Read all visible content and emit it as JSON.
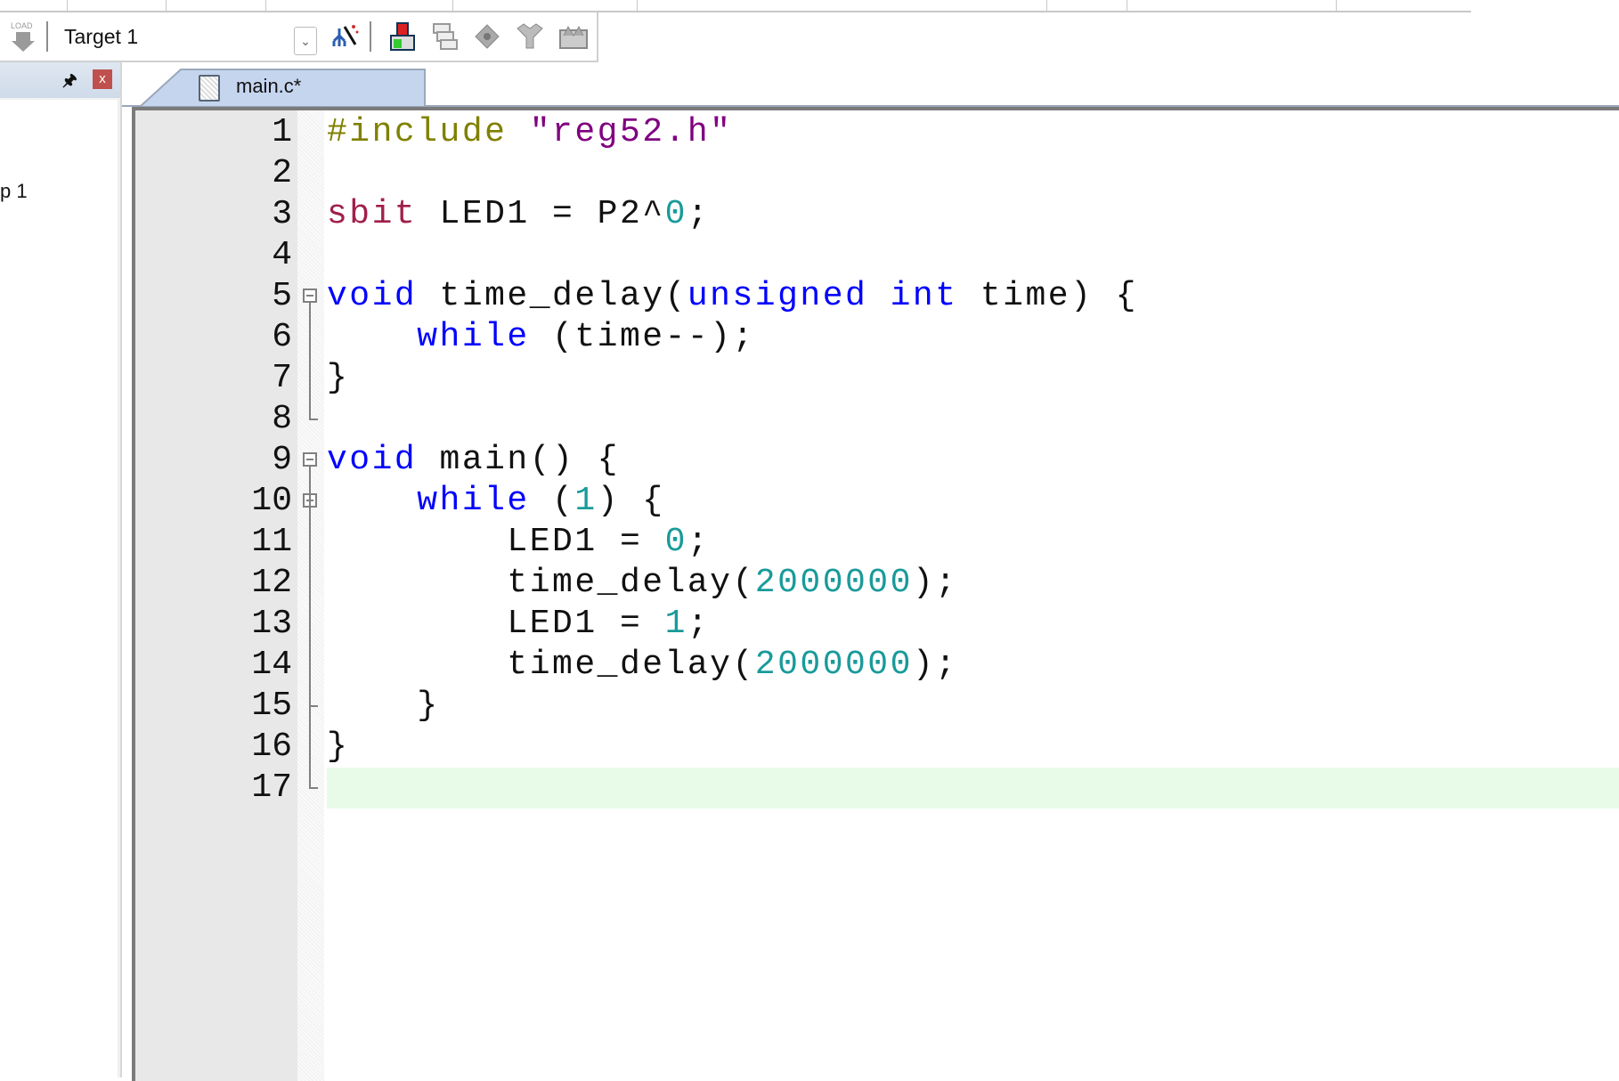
{
  "toolbar": {
    "load_icon_text": "LOAD",
    "target_select": "Target 1",
    "icons": [
      "load-icon",
      "magic-wand-icon",
      "manage-components-icon",
      "batch-build-icon",
      "options-icon",
      "filter-icon",
      "packs-icon"
    ]
  },
  "project_panel": {
    "tree_text": "p 1",
    "pin_icon": "pin-icon",
    "close_label": "x"
  },
  "editor": {
    "tab_label": "main.c*",
    "current_line": 17,
    "lines": [
      [
        {
          "t": "#include ",
          "c": "pp"
        },
        {
          "t": "\"reg52.h\"",
          "c": "str"
        }
      ],
      [],
      [
        {
          "t": "sbit",
          "c": "kw2"
        },
        {
          "t": " LED1 = P2^"
        },
        {
          "t": "0",
          "c": "num"
        },
        {
          "t": ";"
        }
      ],
      [],
      [
        {
          "t": "void",
          "c": "kw"
        },
        {
          "t": " time_delay("
        },
        {
          "t": "unsigned int",
          "c": "kw"
        },
        {
          "t": " time) {"
        }
      ],
      [
        {
          "t": "    "
        },
        {
          "t": "while",
          "c": "kw"
        },
        {
          "t": " (time--);"
        }
      ],
      [
        {
          "t": "}"
        }
      ],
      [],
      [
        {
          "t": "void",
          "c": "kw"
        },
        {
          "t": " main() {"
        }
      ],
      [
        {
          "t": "    "
        },
        {
          "t": "while",
          "c": "kw"
        },
        {
          "t": " ("
        },
        {
          "t": "1",
          "c": "num"
        },
        {
          "t": ") {"
        }
      ],
      [
        {
          "t": "        LED1 = "
        },
        {
          "t": "0",
          "c": "num"
        },
        {
          "t": ";"
        }
      ],
      [
        {
          "t": "        time_delay("
        },
        {
          "t": "2000000",
          "c": "num"
        },
        {
          "t": ");"
        }
      ],
      [
        {
          "t": "        LED1 = "
        },
        {
          "t": "1",
          "c": "num"
        },
        {
          "t": ";"
        }
      ],
      [
        {
          "t": "        time_delay("
        },
        {
          "t": "2000000",
          "c": "num"
        },
        {
          "t": ");"
        }
      ],
      [
        {
          "t": "    }"
        }
      ],
      [
        {
          "t": "}"
        }
      ],
      []
    ],
    "colors": {
      "preprocessor": "#808000",
      "string": "#800080",
      "sbit": "#a0204a",
      "keyword": "#0000ff",
      "number": "#1a9a9a",
      "current_line": "#e8fbe8"
    }
  }
}
